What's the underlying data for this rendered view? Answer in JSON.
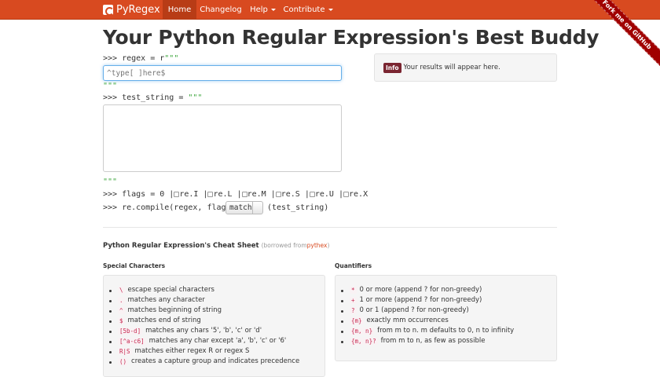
{
  "navbar": {
    "brand": "PyRegex",
    "items": [
      {
        "label": "Home",
        "active": true
      },
      {
        "label": "Changelog",
        "active": false
      },
      {
        "label": "Help",
        "active": false,
        "dropdown": true
      },
      {
        "label": "Contribute",
        "active": false,
        "dropdown": true
      }
    ],
    "ribbon": "Fork me on GitHub",
    "color": "#d84a20"
  },
  "page_title": "Your Python Regular Expression's Best Buddy",
  "editor": {
    "regex_prefix": ">>> regex = r",
    "open_quotes": "\"\"\"",
    "regex_placeholder": "^type[ ]here$",
    "close_quotes": "\"\"\"",
    "test_prefix": ">>> test_string = ",
    "test_open_quotes": "\"\"\"",
    "test_close_quotes": "\"\"\"",
    "flags_prefix": ">>> flags = 0 |",
    "flags": [
      "re.I",
      "re.L",
      "re.M",
      "re.S",
      "re.U",
      "re.X"
    ],
    "compile_prefix": ">>> re.compile(regex, flags).",
    "method": "match",
    "compile_suffix": "(test_string)"
  },
  "results": {
    "badge": "Info",
    "text": "Your results will appear here."
  },
  "cheat_sheet": {
    "title": "Python Regular Expression's Cheat Sheet",
    "borrowed": "(borrowed from",
    "source": "pythex",
    "borrowed_close": ")",
    "special": {
      "title": "Special Characters",
      "items": [
        {
          "code": "\\",
          "text": "escape special characters"
        },
        {
          "code": ".",
          "text": "matches any character"
        },
        {
          "code": "^",
          "text": "matches beginning of string"
        },
        {
          "code": "$",
          "text": "matches end of string"
        },
        {
          "code": "[5b-d]",
          "text": "matches any chars '5', 'b', 'c' or 'd'"
        },
        {
          "code": "[^a-c6]",
          "text": "matches any char except 'a', 'b', 'c' or '6'"
        },
        {
          "code": "R|S",
          "text": "matches either regex R or regex S"
        },
        {
          "code": "()",
          "text": "creates a capture group and indicates precedence"
        }
      ]
    },
    "quantifiers": {
      "title": "Quantifiers",
      "items": [
        {
          "code": "*",
          "text": "0 or more (append ? for non-greedy)"
        },
        {
          "code": "+",
          "text": "1 or more (append ? for non-greedy)"
        },
        {
          "code": "?",
          "text": "0 or 1 (append ? for non-greedy)"
        },
        {
          "code": "{m}",
          "text": "exactly mm occurrences"
        },
        {
          "code": "{m, n}",
          "text": "from m to n. m defaults to 0, n to infinity"
        },
        {
          "code": "{m, n}?",
          "text": "from m to n, as few as possible"
        }
      ]
    }
  }
}
